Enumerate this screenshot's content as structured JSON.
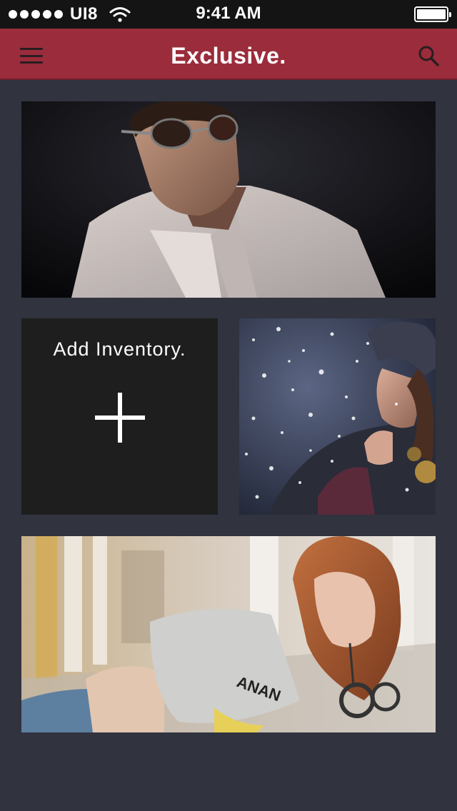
{
  "status_bar": {
    "carrier": "UI8",
    "time": "9:41 AM",
    "icons": [
      "signal-dots",
      "wifi-icon",
      "battery-icon"
    ]
  },
  "nav": {
    "title": "Exclusive.",
    "menu_icon": "menu-icon",
    "search_icon": "search-icon"
  },
  "tiles": {
    "add_label": "Add Inventory.",
    "add_icon": "plus-icon"
  },
  "colors": {
    "nav_bar": "#9b2c3b",
    "background": "#31333f",
    "status_bar": "#141414",
    "add_tile": "#1e1e1e"
  }
}
